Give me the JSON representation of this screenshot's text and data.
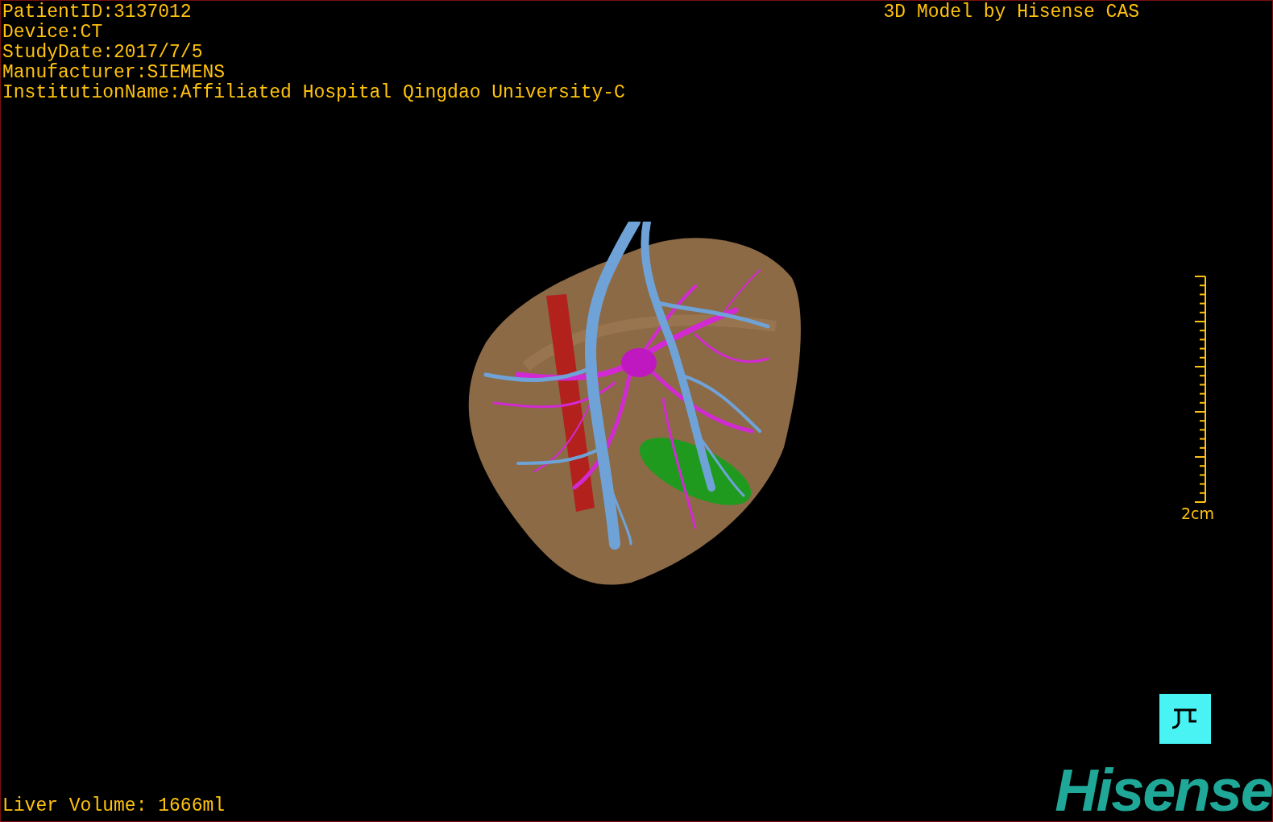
{
  "viewer": {
    "title": "3D Model by Hisense CAS",
    "study_info": [
      "PatientID:3137012",
      "Device:CT",
      "StudyDate:2017/7/5",
      "Manufacturer:SIEMENS",
      "InstitutionName:Affiliated Hospital Qingdao University-C"
    ],
    "scale_bar": {
      "label": "2cm"
    },
    "liver_volume": "Liver Volume: 1666ml",
    "logo": "Hisense"
  }
}
